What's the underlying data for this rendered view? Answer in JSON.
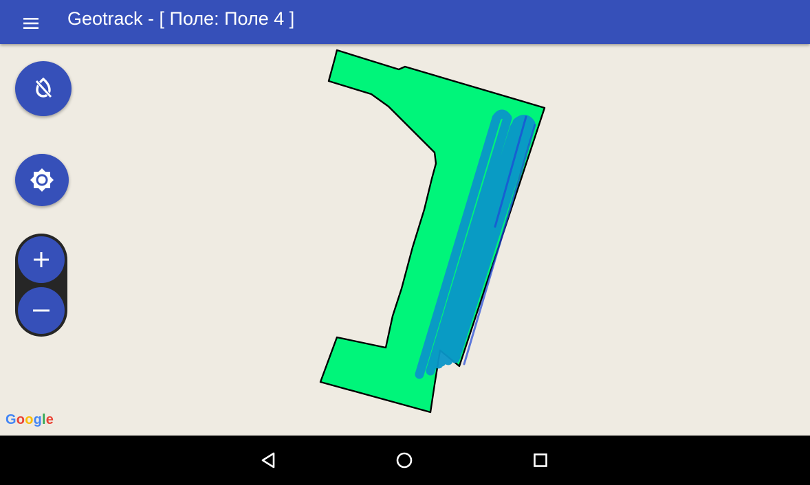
{
  "app_bar": {
    "title": "Geotrack - [ Поле: Поле 4 ]",
    "background_color": "#3650b9",
    "menu_icon": "hamburger-menu-icon"
  },
  "map": {
    "background_color": "#efebe2",
    "field": {
      "fill_color": "#00f57a",
      "outline_color": "#000000"
    },
    "track": {
      "color": "#0a96c8",
      "accent_color": "#1e46d8"
    },
    "attribution": {
      "letters": [
        "G",
        "o",
        "o",
        "g",
        "l",
        "e"
      ]
    }
  },
  "controls": {
    "location_button_icon": "location-disabled-icon",
    "settings_button_icon": "brightness-gear-icon",
    "zoom_in_icon": "plus-icon",
    "zoom_out_icon": "minus-icon",
    "accent_color": "#3650b9"
  },
  "system_nav": {
    "back_icon": "back-triangle-icon",
    "home_icon": "home-circle-icon",
    "recents_icon": "recents-square-icon"
  }
}
